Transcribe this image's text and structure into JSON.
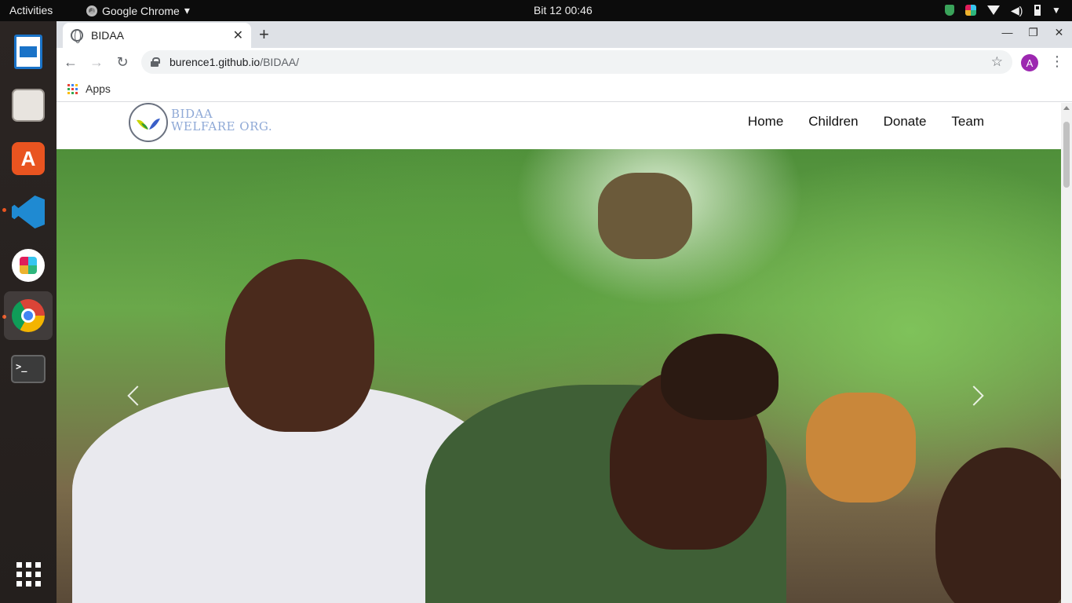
{
  "system": {
    "activities": "Activities",
    "app_name": "Google Chrome",
    "clock": "Bit 12  00:46"
  },
  "browser": {
    "tab_title": "BIDAA",
    "url_host": "burence1.github.io",
    "url_path": "/BIDAA/",
    "avatar_letter": "A",
    "bookmarks_apps": "Apps"
  },
  "site": {
    "logo_line1": "BIDAA",
    "logo_line2": "WELFARE ORG.",
    "nav": [
      "Home",
      "Children",
      "Donate",
      "Team"
    ]
  },
  "colors": {
    "accent_dock": "#e95420",
    "avatar": "#9c27b0",
    "logo_text": "#8fa9d6"
  },
  "icons": {
    "dock": [
      "writer-icon",
      "files-icon",
      "software-icon",
      "vscode-icon",
      "slack-icon",
      "chrome-icon",
      "terminal-icon",
      "show-apps-icon"
    ]
  }
}
